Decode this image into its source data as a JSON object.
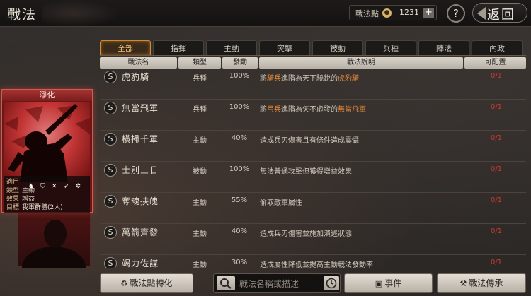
{
  "header": {
    "title": "戰法",
    "points_label": "戰法點",
    "points_icon": "coin-icon",
    "points_value": "1231",
    "plus": "+",
    "help": "?",
    "back": "返回"
  },
  "tabs": [
    "全部",
    "指揮",
    "主動",
    "突擊",
    "被動",
    "兵種",
    "陣法",
    "內政"
  ],
  "active_tab": "全部",
  "table": {
    "headers": [
      "戰法名",
      "類型",
      "發動",
      "戰法說明",
      "可配置"
    ],
    "rows": [
      {
        "badge": "S",
        "name": "虎豹騎",
        "type": "兵種",
        "rate": "100%",
        "desc_a": "將",
        "desc_hl1": "騎兵",
        "desc_b": "進階為天下驍銳的",
        "desc_hl2": "虎豹騎",
        "desc_c": "",
        "cfg": "0/1"
      },
      {
        "badge": "S",
        "name": "無當飛軍",
        "type": "兵種",
        "rate": "100%",
        "desc_a": "將",
        "desc_hl1": "弓兵",
        "desc_b": "進階為矢不虛發的",
        "desc_hl2": "無當飛軍",
        "desc_c": "",
        "cfg": "0/1"
      },
      {
        "badge": "S",
        "name": "橫掃千軍",
        "type": "主動",
        "rate": "40%",
        "desc_a": "造成兵刃傷害且有條件造成震懾",
        "desc_hl1": "",
        "desc_b": "",
        "desc_hl2": "",
        "desc_c": "",
        "cfg": "0/1"
      },
      {
        "badge": "S",
        "name": "士別三日",
        "type": "被動",
        "rate": "100%",
        "desc_a": "無法普通攻擊但獲得增益效果",
        "desc_hl1": "",
        "desc_b": "",
        "desc_hl2": "",
        "desc_c": "",
        "cfg": "0/1"
      },
      {
        "badge": "S",
        "name": "奪魂挾魄",
        "type": "主動",
        "rate": "55%",
        "desc_a": "偷取敵軍屬性",
        "desc_hl1": "",
        "desc_b": "",
        "desc_hl2": "",
        "desc_c": "",
        "cfg": "0/1"
      },
      {
        "badge": "S",
        "name": "萬箭齊發",
        "type": "主動",
        "rate": "40%",
        "desc_a": "造成兵刃傷害並施加潰逃狀態",
        "desc_hl1": "",
        "desc_b": "",
        "desc_hl2": "",
        "desc_c": "",
        "cfg": "0/1"
      },
      {
        "badge": "S",
        "name": "竭力佐謀",
        "type": "主動",
        "rate": "30%",
        "desc_a": "造成屬性降低並提高主動戰法發動率",
        "desc_hl1": "",
        "desc_b": "",
        "desc_hl2": "",
        "desc_c": "",
        "cfg": "0/1"
      }
    ]
  },
  "card": {
    "title": "淨化",
    "applies_label": "適用",
    "applies_icons": [
      "cavalry-icon",
      "shield-icon",
      "crossed-spears-icon",
      "bow-icon",
      "wheel-icon"
    ],
    "type_label": "類型",
    "type_value": "主動",
    "effect_label": "效果",
    "effect_value": "增益",
    "target_label": "目標",
    "target_value": "我軍群體(2人)"
  },
  "bottom": {
    "convert_button": "戰法點轉化",
    "search_placeholder": "戰法名稱或描述",
    "event_button": "事件",
    "inherit_button": "戰法傳承"
  },
  "colors": {
    "accent": "#d08a2e",
    "highlight": "#e38a3b",
    "config_red": "#c83a2a",
    "card_red": "#6e1515"
  }
}
